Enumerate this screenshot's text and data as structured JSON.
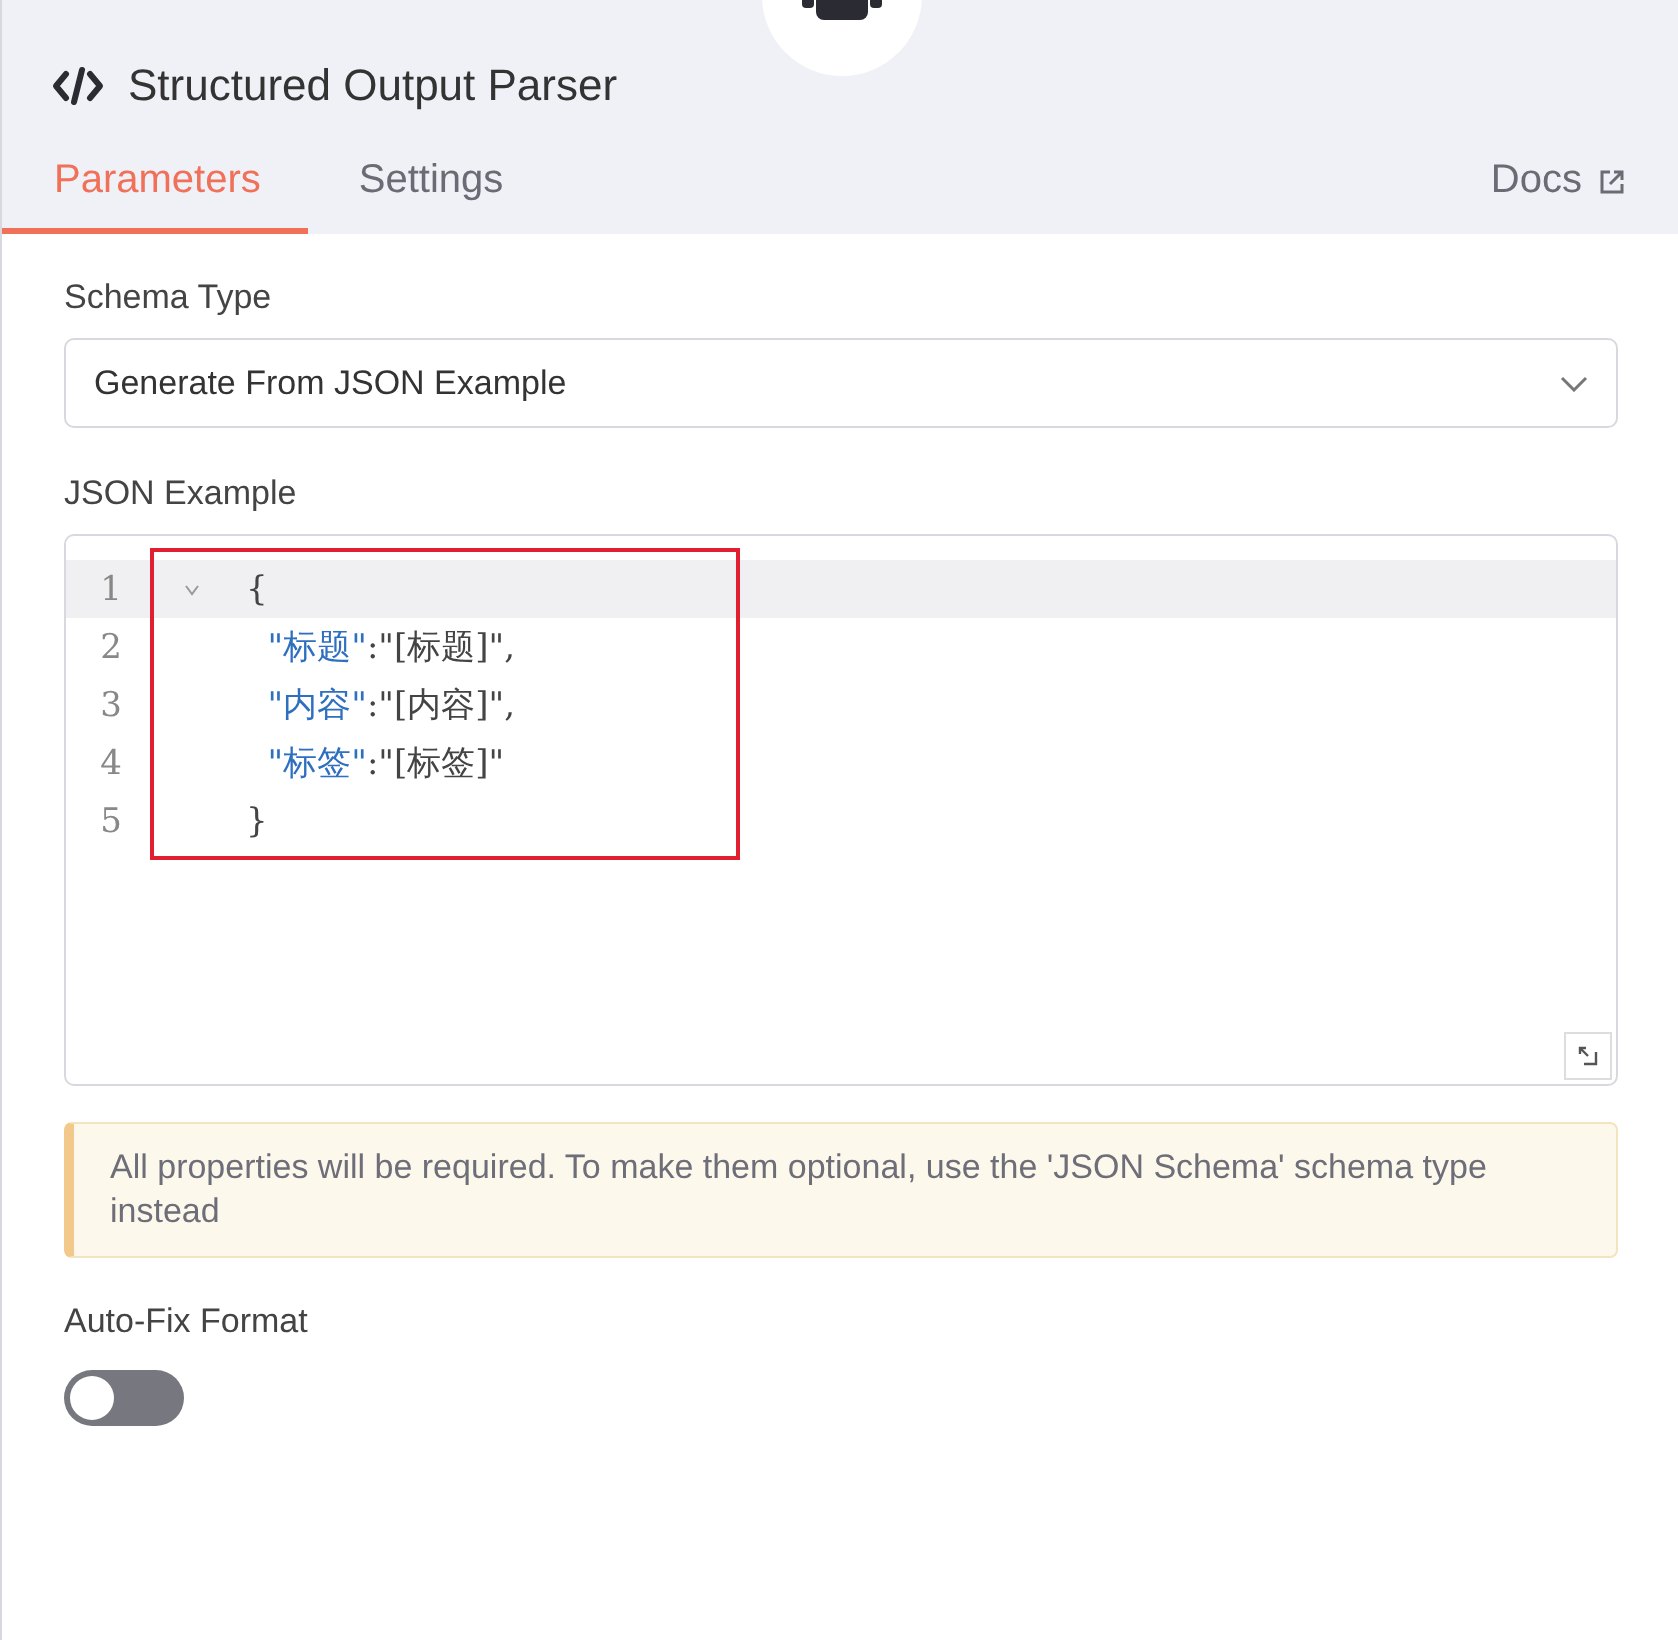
{
  "header": {
    "title": "Structured Output Parser"
  },
  "tabs": [
    {
      "label": "Parameters",
      "selected": true
    },
    {
      "label": "Settings",
      "selected": false
    }
  ],
  "docs_link": {
    "label": "Docs"
  },
  "schema_type": {
    "label": "Schema Type",
    "value": "Generate From JSON Example"
  },
  "json_example": {
    "label": "JSON Example",
    "highlighted": true,
    "lines": [
      {
        "number": "1",
        "active": true,
        "foldable": true,
        "tokens": [
          {
            "kind": "punct",
            "text": "{"
          }
        ]
      },
      {
        "number": "2",
        "active": false,
        "foldable": false,
        "tokens": [
          {
            "kind": "key",
            "text": "  \"标题\""
          },
          {
            "kind": "punct",
            "text": ":\"[标题]\","
          }
        ]
      },
      {
        "number": "3",
        "active": false,
        "foldable": false,
        "tokens": [
          {
            "kind": "key",
            "text": "  \"内容\""
          },
          {
            "kind": "punct",
            "text": ":\"[内容]\","
          }
        ]
      },
      {
        "number": "4",
        "active": false,
        "foldable": false,
        "tokens": [
          {
            "kind": "key",
            "text": "  \"标签\""
          },
          {
            "kind": "punct",
            "text": ":\"[标签]\""
          }
        ]
      },
      {
        "number": "5",
        "active": false,
        "foldable": false,
        "tokens": [
          {
            "kind": "punct",
            "text": "}"
          }
        ]
      }
    ]
  },
  "notice": {
    "text": "All properties will be required. To make them optional, use the 'JSON Schema' schema type instead"
  },
  "auto_fix": {
    "label": "Auto-Fix Format",
    "on": false
  }
}
